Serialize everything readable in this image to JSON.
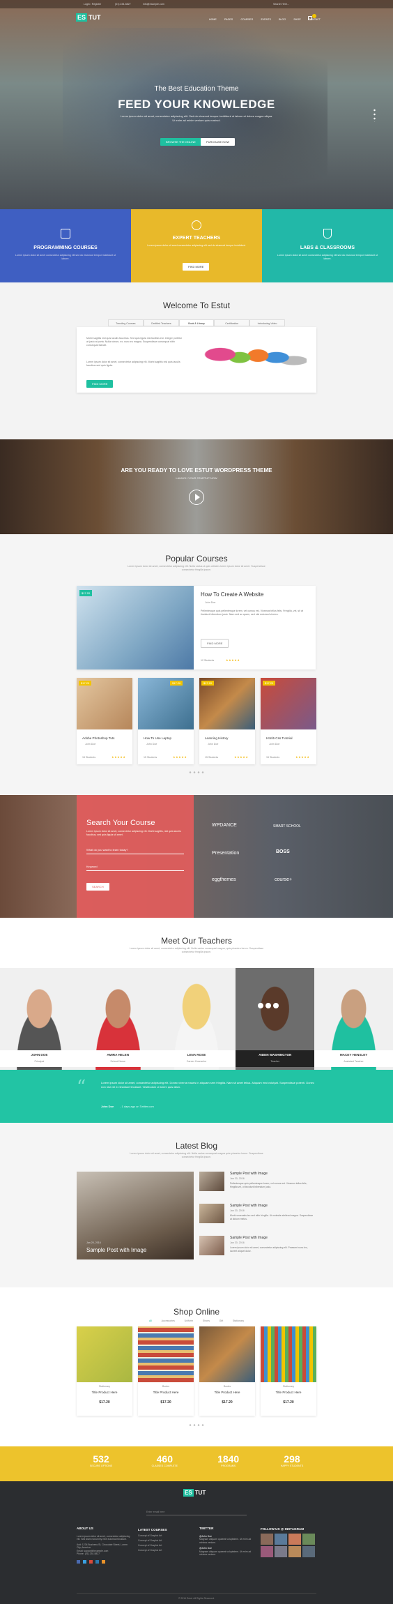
{
  "topbar": {
    "login": "Login / Register",
    "phone": "(01) 234-5827",
    "email": "info@example.com",
    "search": "Search Here..."
  },
  "brand": {
    "logo_a": "ES",
    "logo_b": "TUT"
  },
  "nav": [
    "HOME",
    "PAGES",
    "COURSES",
    "EVENTS",
    "BLOG",
    "SHOP",
    "CONTACT"
  ],
  "hero": {
    "small": "The Best Education Theme",
    "title": "FEED YOUR KNOWLEDGE",
    "desc": "Lorem ipsum dolor sit amet, consectetur adipiscing elit. Sed do eiusmod tempor incididunt ut labore et dolore magna aliqua. Ut enim ad minim veniam quis nostrud.",
    "btn1": "BROWSE THE ONLINE",
    "btn2": "PURCHASE NOW"
  },
  "features": [
    {
      "title": "PROGRAMMING COURSES",
      "text": "Lorem ipsum dolor sit amet consectetur adipiscing elit sed do eiusmod tempor incididunt ut labore."
    },
    {
      "title": "EXPERT TEACHERS",
      "text": "Lorem ipsum dolor sit amet consectetur adipiscing elit sed do eiusmod tempor incididunt.",
      "btn": "FIND MORE"
    },
    {
      "title": "LABS & CLASSROOMS",
      "text": "Lorem ipsum dolor sit amet consectetur adipiscing elit sed do eiusmod tempor incididunt ut labore."
    }
  ],
  "welcome": {
    "title": "Welcome To Estut",
    "tabs": [
      "Trending Courses",
      "Certified Teachers",
      "Book & Library",
      "Certification",
      "Introducing Video"
    ],
    "p1": "Morbi sagittis nisl quis iaculis faucibus. Sed quis ligula nisl facilisis est. Integer porttitor at justo at porta. Nulla rutrum, ex, nunc eu magna. Suspendisse consequat nibh consequat blandit.",
    "p2": "Lorem ipsum dolor sit amet, consectetur adipiscing elit. Morbi sagittis nisl quis iaculis faucibus sed quis ligula.",
    "btn": "FIND MORE"
  },
  "cta": {
    "title": "ARE YOU READY TO LOVE ESTUT WORDPRESS THEME",
    "sub": "LAUNCH YOUR STARTUP NOW"
  },
  "popular": {
    "title": "Popular Courses",
    "desc": "Lorem ipsum dolor sit amet, consectetur adipiscing elit. Nulla varius ut quis ultricies lorem ipsum dolor sit amet. Suspendisse consectetur fringilla ipsum.",
    "featured": {
      "price": "$17.20",
      "title": "How To Create A Website",
      "author": "John Doe",
      "text": "Pellentesque quis pellentesque lorem, vel cursus est. Vivamus tellus felis. Fringilla, vel, sit at tincidunt bibendum justo. Nam sed ac quam, sed nisl euismod viverra.",
      "btn": "FIND MORE",
      "students": "12 Students"
    },
    "cards": [
      {
        "price": "$17.20",
        "title": "Adobe Photoshop Tuts",
        "author": "John Doe",
        "students": "15 Students"
      },
      {
        "price": "$17.20",
        "title": "How To Use Laptop",
        "author": "John Doe",
        "students": "15 Students"
      },
      {
        "price": "$17.20",
        "title": "Learning History",
        "author": "John Doe",
        "students": "15 Students"
      },
      {
        "price": "$17.20",
        "title": "Html5 Css Tutorial",
        "author": "John Doe",
        "students": "15 Students"
      }
    ]
  },
  "search": {
    "title": "Search Your Course",
    "text": "Lorem ipsum dolor sit amet, consectetur adipiscing elit. Morbi sagittis, nisl quis iaculis faucibus, sed quis ligula sit amet.",
    "field1": "What do you want to learn today?",
    "field2": "Keyword",
    "btn": "SEARCH",
    "partners": [
      "WPDANCE",
      "SMART SCHOOL",
      "Presentation",
      "BOSS",
      "eggthemes",
      "course+"
    ]
  },
  "teachers": {
    "title": "Meet Our Teachers",
    "desc": "Lorem ipsum dolor sit amet, consectetur adipiscing elit. Nulla varius consequat magna, quis pharetra lorem. Suspendisse consectetur fringilla ipsum.",
    "list": [
      {
        "name": "JOHN DOE",
        "role": "Principal"
      },
      {
        "name": "AMIRA HELEN",
        "role": "School Nurse"
      },
      {
        "name": "LENA ROSE",
        "role": "Career Counselor"
      },
      {
        "name": "AIDEN WASHINGTON",
        "role": "Teacher"
      },
      {
        "name": "MACEY HENSLEY",
        "role": "Assistant Teacher"
      }
    ]
  },
  "quote": {
    "text": "Lorem ipsum dolor sit amet, consectetur adipiscing elit. Donec viverra mauris in aliquam sem fringilla. Nam sit amet tellus. Aliquam erat volutpat. Suspendisse potenti. Donec non nisl vel ex tincidunt tincidunt. Vestibulum ut lorem quis diam.",
    "author": "John Doe",
    "meta": "- 1 days ago on Twitter.com"
  },
  "blog": {
    "title": "Latest Blog",
    "desc": "Lorem ipsum dolor sit amet, consectetur adipiscing elit. Nulla varius consequat magna quis pharetra lorem. Suspendisse consectetur fringilla ipsum.",
    "feature_date": "Jan 20, 2016",
    "feature_title": "Sample Post with Image",
    "posts": [
      {
        "title": "Sample Post with Image",
        "date": "Jan 20, 2016",
        "text": "Pellentesque quis pellentesque lorem, vel cursus est. Vivamus tellus felis, fringilla vel, ut tincidunt bibendum justo."
      },
      {
        "title": "Sample Post with Image",
        "date": "Jan 20, 2016",
        "text": "Morbi venenatis leo sed nibh fringilla. Ut molestie eleifend magna. Suspendisse at dictum metus."
      },
      {
        "title": "Sample Post with Image",
        "date": "Jan 20, 2016",
        "text": "Lorem ipsum dolor sit amet, consectetur adipiscing elit. Praesent nunc leo, laoreet aliquet dolor."
      }
    ]
  },
  "shop": {
    "title": "Shop Online",
    "filters": [
      "All",
      "Accessories",
      "Uniform",
      "Shoes",
      "Gift",
      "Stationary"
    ],
    "products": [
      {
        "cat": "Stationary",
        "title": "Title Product Here",
        "price": "$17.20"
      },
      {
        "cat": "Books",
        "title": "Title Product Here",
        "price": "$17.20"
      },
      {
        "cat": "Books",
        "title": "Title Product Here",
        "price": "$17.20"
      },
      {
        "cat": "Stationary",
        "title": "Title Product Here",
        "price": "$17.20"
      }
    ]
  },
  "stats": [
    {
      "num": "532",
      "label": "SECURE OPTIONS"
    },
    {
      "num": "460",
      "label": "CLASSES COMPLETE"
    },
    {
      "num": "1840",
      "label": "PROGRAMS"
    },
    {
      "num": "298",
      "label": "HAPPY STUDENTS"
    }
  ],
  "footer": {
    "newsletter": "Enter email here",
    "about_title": "ABOUT US",
    "about_text": "Lorem ipsum dolor sit amet, consectetur adipiscing elit. Sed diam nonummy nibh euismod tincidunt.",
    "addr": "Add: 1234 Business St, Chocolate Street, Lorem City, America",
    "mail": "Email: support@example.com",
    "phone": "Phone: (01) 234-5827",
    "courses_title": "LATEST COURSES",
    "courses": [
      "Concept of Graphic Art",
      "Concept of Graphic Art",
      "Concept of Graphic Art",
      "Concept of Graphic Art"
    ],
    "twitter_title": "TWITTER",
    "tw_user": "@John Doe",
    "tw_text": "Magnam aliquam quaerat voluptatem. Ut enim ad minima veniam.",
    "insta_title": "FOLLOW US @ INSTAGRAM",
    "copyright": "© 2016 Estut. All Rights Reserved."
  }
}
